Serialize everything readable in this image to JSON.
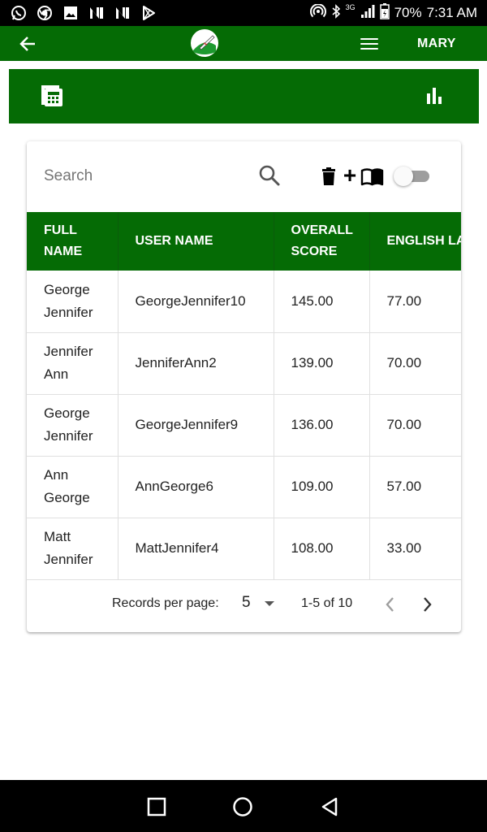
{
  "status_bar": {
    "network_type": "3G",
    "battery": "70%",
    "time": "7:31 AM",
    "left_icons": [
      "whatsapp-icon",
      "chrome-icon",
      "image-icon",
      "n-app-icon",
      "n-app-icon",
      "play-store-icon"
    ],
    "right_icons": [
      "hotspot-icon",
      "bluetooth-icon",
      "signal-icon",
      "battery-icon"
    ]
  },
  "app_bar": {
    "user": "MARY",
    "background": "#056b05"
  },
  "search": {
    "placeholder": "Search"
  },
  "table": {
    "headers": [
      "FULL NAME",
      "USER NAME",
      "OVERALL SCORE",
      "ENGLISH LANGUAGE"
    ],
    "rows": [
      [
        "George Jennifer",
        "GeorgeJennifer10",
        "145.00",
        "77.00"
      ],
      [
        "Jennifer Ann",
        "JenniferAnn2",
        "139.00",
        "70.00"
      ],
      [
        "George Jennifer",
        "GeorgeJennifer9",
        "136.00",
        "70.00"
      ],
      [
        "Ann George",
        "AnnGeorge6",
        "109.00",
        "57.00"
      ],
      [
        "Matt Jennifer",
        "MattJennifer4",
        "108.00",
        "33.00"
      ]
    ]
  },
  "pagination": {
    "label": "Records per page:",
    "per_page": "5",
    "range": "1-5 of 10"
  },
  "colors": {
    "primary_green": "#056b05",
    "toggle_track": "#9e9e9e"
  }
}
